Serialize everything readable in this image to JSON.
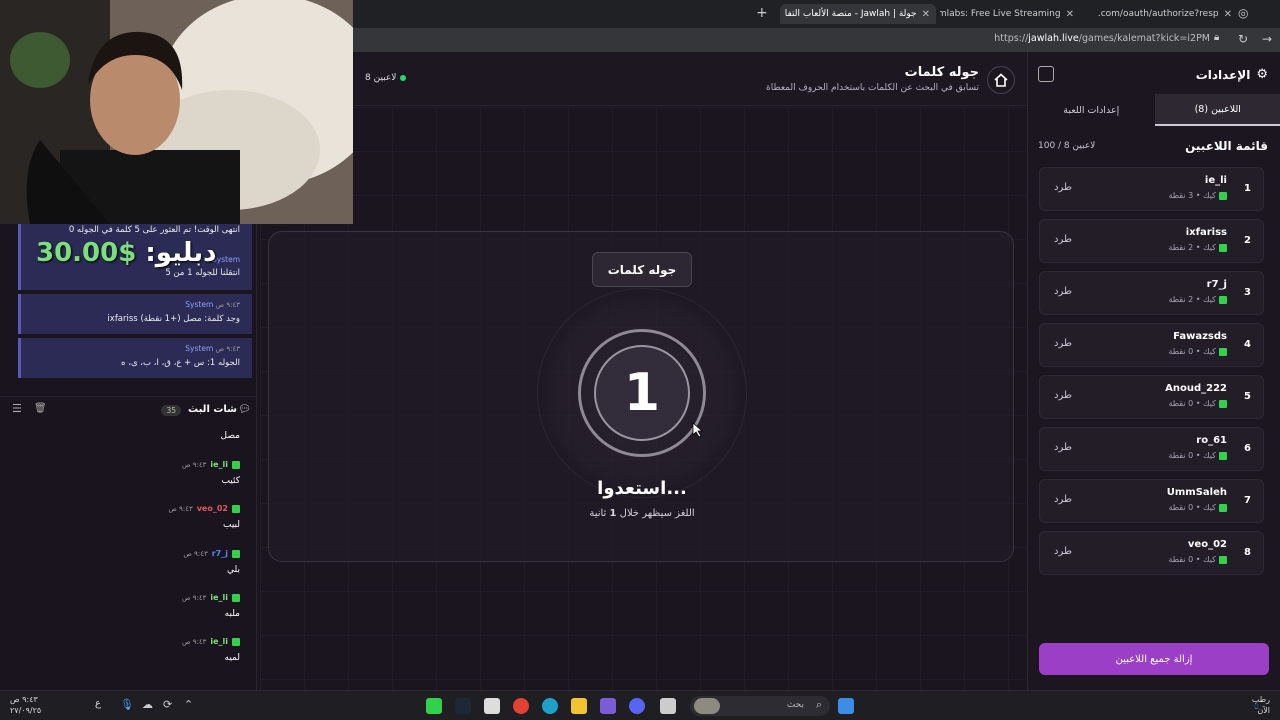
{
  "browser": {
    "tabs": [
      {
        "label": "جولة | Jawlah - منصة الألعاب التفا",
        "active": true
      },
      {
        "label": "Streamlabs: Free Live Streaming &",
        "active": false
      },
      {
        "label": "id.kick.com/oauth/authorize?resp",
        "active": false
      }
    ],
    "url_prefix": "https://",
    "url_host": "jawlah.live",
    "url_path": "/games/kalemat?kick=i2PM"
  },
  "header": {
    "title": "جوله كلمات",
    "subtitle": "تسابق في البحث عن الكلمات باستخدام الحروف المعطاة",
    "players_online": "8 لاعبين"
  },
  "center": {
    "badge": "جوله كلمات",
    "countdown": "1",
    "ready_text": "استعدوا...",
    "sub_text_before": "اللغز سيظهر خلال",
    "sub_text_num": "1",
    "sub_text_after": "ثانية"
  },
  "sidebar": {
    "title": "الإعدادات",
    "tabs": [
      "اللاعبين (8)",
      "إعدادات اللعبة"
    ],
    "list_title": "قائمة اللاعبين",
    "list_count": "100 / 8 لاعبين",
    "kick_label": "طرد",
    "players": [
      {
        "num": "1",
        "name": "ie_li",
        "meta": "كيك • 3 نقطة"
      },
      {
        "num": "2",
        "name": "ixfariss",
        "meta": "كيك • 2 نقطة"
      },
      {
        "num": "3",
        "name": "r7_j",
        "meta": "كيك • 2 نقطة"
      },
      {
        "num": "4",
        "name": "Fawazsds",
        "meta": "كيك • 0 نقطة"
      },
      {
        "num": "5",
        "name": "Anoud_222",
        "meta": "كيك • 0 نقطة"
      },
      {
        "num": "6",
        "name": "ro_61",
        "meta": "كيك • 0 نقطة"
      },
      {
        "num": "7",
        "name": "UmmSaleh",
        "meta": "كيك • 0 نقطة"
      },
      {
        "num": "8",
        "name": "veo_02",
        "meta": "كيك • 0 نقطة"
      }
    ],
    "remove_all": "إزالة جميع اللاعبين"
  },
  "chat": {
    "overlay_price": "$30.00",
    "overlay_name": "دبليو:",
    "system_messages": [
      {
        "tag": "System",
        "time": "",
        "body": "انتهى الوقت! تم العثور على 5 كلمة في الجوله 0"
      },
      {
        "tag": "System",
        "time": "",
        "body": "انتقلنا للجوله 1 من 5"
      },
      {
        "tag": "System",
        "time": "٩:٤٣ ص",
        "body": "ixfariss وجد كلمة: مصل (+1 نقطة)"
      },
      {
        "tag": "System",
        "time": "٩:٤٣ ص",
        "body": "الجوله 1: س + ع، ق، ا، ب، ى، ه"
      }
    ],
    "title": "شات البث",
    "count": "35",
    "messages": [
      {
        "user": "",
        "time": "",
        "text": "مصل",
        "color": "#ffffff"
      },
      {
        "user": "ie_li",
        "time": "٩:٤٣ ص",
        "text": "كئيب",
        "color": "#7be07b"
      },
      {
        "user": "veo_02",
        "time": "٩:٤٣ ص",
        "text": "لبيب",
        "color": "#e05a5a"
      },
      {
        "user": "r7_j",
        "time": "٩:٤٣ ص",
        "text": "بلي",
        "color": "#4f8cf0"
      },
      {
        "user": "ie_li",
        "time": "٩:٤٣ ص",
        "text": "ملبه",
        "color": "#7be07b"
      },
      {
        "user": "ie_li",
        "time": "٩:٤٣ ص",
        "text": "لميه",
        "color": "#7be07b"
      }
    ]
  },
  "taskbar": {
    "search": "بحث",
    "time": "٩:٤٣ ص",
    "date": "٢٧/٠٩/٢٥",
    "weather_1": "رطب",
    "weather_2": "الآن"
  },
  "colors": {
    "accent": "#9b3fc7",
    "online": "#22dd66",
    "kick": "#31d24a"
  }
}
